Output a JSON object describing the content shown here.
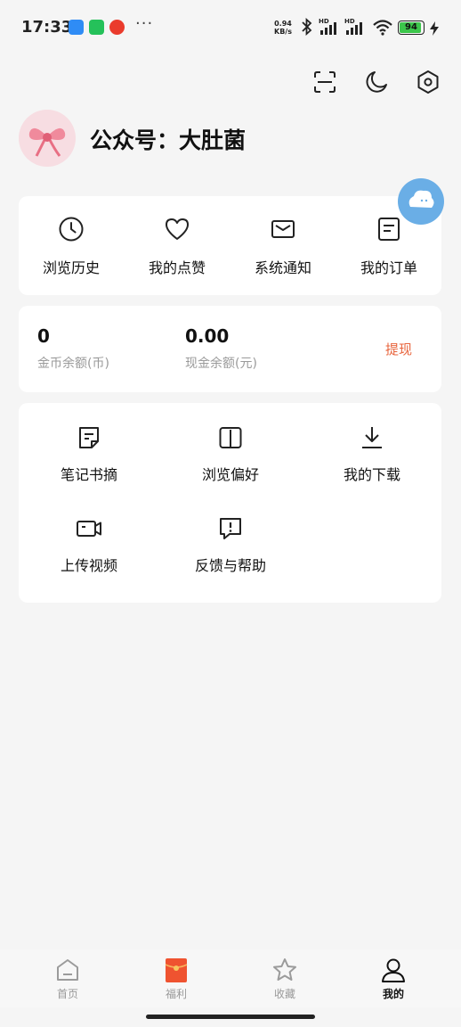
{
  "status_bar": {
    "time": "17:33",
    "dots": "···",
    "net_speed_value": "0.94",
    "net_speed_unit": "KB/s",
    "signal_tag_1": "HD",
    "signal_tag_2": "HD",
    "battery_level": "94",
    "battery_color": "#3cc64b"
  },
  "header": {
    "icons": [
      "scan-icon",
      "moon-icon",
      "settings-hexagon-icon"
    ],
    "profile_name": "公众号：大肚菌"
  },
  "quick_actions": [
    {
      "label": "浏览历史",
      "icon": "clock-icon"
    },
    {
      "label": "我的点赞",
      "icon": "heart-icon"
    },
    {
      "label": "系统通知",
      "icon": "envelope-icon"
    },
    {
      "label": "我的订单",
      "icon": "order-icon"
    }
  ],
  "balance": {
    "coins_value": "0",
    "coins_label": "金币余额(币)",
    "cash_value": "0.00",
    "cash_label": "现金余额(元)",
    "withdraw_label": "提现",
    "accent_color": "#e8643c"
  },
  "tools": [
    {
      "label": "笔记书摘",
      "icon": "note-icon"
    },
    {
      "label": "浏览偏好",
      "icon": "book-icon"
    },
    {
      "label": "我的下载",
      "icon": "download-icon"
    },
    {
      "label": "上传视频",
      "icon": "video-camera-icon"
    },
    {
      "label": "反馈与帮助",
      "icon": "feedback-icon"
    }
  ],
  "tab_bar": [
    {
      "label": "首页",
      "icon": "home-icon",
      "active": false
    },
    {
      "label": "福利",
      "icon": "red-envelope-icon",
      "active": false
    },
    {
      "label": "收藏",
      "icon": "star-icon",
      "active": false
    },
    {
      "label": "我的",
      "icon": "person-icon",
      "active": true
    }
  ]
}
